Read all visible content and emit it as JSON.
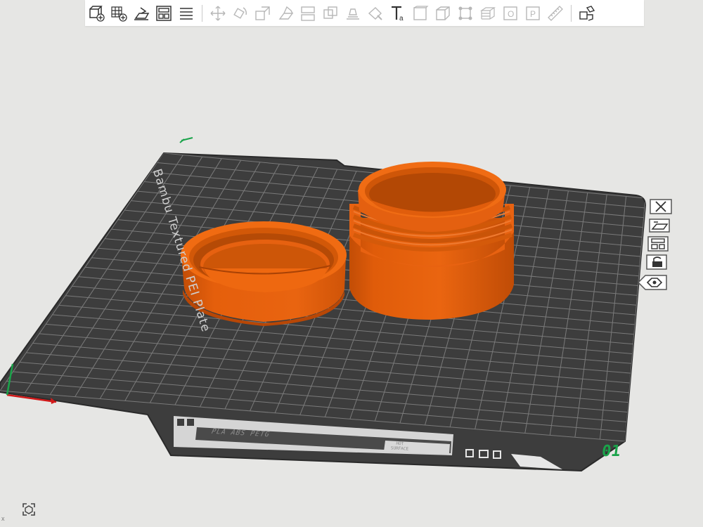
{
  "toolbar": {
    "items": [
      {
        "name": "add-object-icon",
        "enabled": true
      },
      {
        "name": "add-plate-icon",
        "enabled": true
      },
      {
        "name": "auto-orient-icon",
        "enabled": true
      },
      {
        "name": "arrange-icon",
        "enabled": true
      },
      {
        "name": "split-to-objects-icon",
        "enabled": true
      },
      {
        "name": "move-icon",
        "enabled": false
      },
      {
        "name": "rotate-icon",
        "enabled": false
      },
      {
        "name": "scale-icon",
        "enabled": false
      },
      {
        "name": "lay-on-face-icon",
        "enabled": false
      },
      {
        "name": "cut-icon",
        "enabled": false
      },
      {
        "name": "mesh-boolean-icon",
        "enabled": false
      },
      {
        "name": "support-paint-icon",
        "enabled": false
      },
      {
        "name": "seam-paint-icon",
        "enabled": false
      },
      {
        "name": "text-icon",
        "enabled": true
      },
      {
        "name": "measure-icon",
        "enabled": false
      },
      {
        "name": "assembly-icon",
        "enabled": false
      },
      {
        "name": "brim-ears-icon",
        "enabled": false
      },
      {
        "name": "variable-layer-height-icon",
        "enabled": false
      },
      {
        "name": "object-list-icon",
        "enabled": false
      },
      {
        "name": "process-icon",
        "enabled": false
      },
      {
        "name": "ruler-icon",
        "enabled": false
      },
      {
        "name": "explode-view-icon",
        "enabled": true
      }
    ],
    "text_tool_label": "Ta",
    "object_tool_label": "O",
    "process_tool_label": "P"
  },
  "plate": {
    "name": "Bambu Textured PEI Plate",
    "number": "01",
    "filament_label": "PLA ABS PETG",
    "surface_label_line1": "HOT",
    "surface_label_line2": "SURFACE"
  },
  "plate_controls": [
    {
      "name": "close-plate-icon"
    },
    {
      "name": "auto-orient-plate-icon"
    },
    {
      "name": "arrange-plate-icon"
    },
    {
      "name": "lock-plate-icon"
    },
    {
      "name": "plate-settings-icon"
    }
  ],
  "axis_x_label": "x",
  "colors": {
    "background": "#e6e6e4",
    "plate": "#3d3d3d",
    "grid": "#8a8a8a",
    "object": "#e8600a",
    "plate_number": "#1aa34a",
    "axis_x": "#d11a1a",
    "axis_y": "#1aa34a"
  }
}
